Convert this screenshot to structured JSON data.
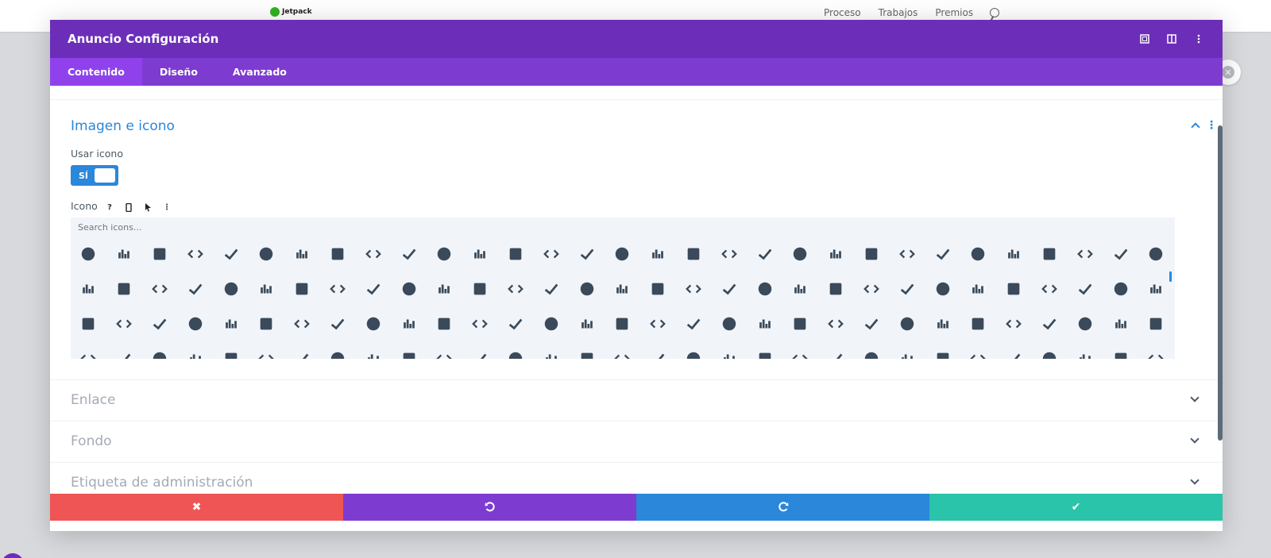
{
  "site": {
    "logo_text": "Jetpack",
    "nav": [
      "Proceso",
      "Trabajos",
      "Premios"
    ]
  },
  "modal": {
    "title": "Anuncio Configuración",
    "tabs": [
      {
        "label": "Contenido",
        "active": true
      },
      {
        "label": "Diseño",
        "active": false
      },
      {
        "label": "Avanzado",
        "active": false
      }
    ],
    "section": {
      "title": "Imagen e icono",
      "use_icon_label": "Usar icono",
      "toggle_value": "SÍ",
      "icon_label": "Icono",
      "search_placeholder": "Search icons..."
    },
    "collapsed_sections": [
      "Enlace",
      "Fondo",
      "Etiqueta de administración"
    ],
    "footer_colors": {
      "cancel": "#ef5555",
      "undo": "#7e3bd0",
      "redo": "#2b87da",
      "save": "#29c4a9"
    }
  },
  "icons": [
    "area-chart-icon",
    "bar-chart-icon",
    "bar-chart-outline-icon",
    "line-chart-icon",
    "pie-chart-icon",
    "check-icon",
    "check-circle-icon",
    "check-circle-outline-icon",
    "check-double-icon",
    "check-square-outline-icon",
    "check-square-icon",
    "chess-icon",
    "chess-bishop-icon",
    "chessboard-icon",
    "chess-king-icon",
    "chess-knight-icon",
    "chess-pawn-icon",
    "chess-queen-icon",
    "chess-rook-icon",
    "chevron-circle-down-icon",
    "chevron-circle-left-icon",
    "chevron-circle-right-icon",
    "chevron-circle-up-icon",
    "chevron-down-icon",
    "chevron-left-icon",
    "chevron-right-icon",
    "chevron-up-icon",
    "child-icon",
    "chrome-icon",
    "church-icon",
    "circle-icon",
    "circle-outline-icon",
    "circle-notch-icon",
    "clipboard-icon",
    "clipboard-solid-icon",
    "clipboard-check-icon",
    "clipboard-list-icon",
    "clock-outline-icon",
    "clock-icon",
    "clone-outline-icon",
    "clone-icon",
    "closed-captioning-icon",
    "closed-captioning-outline-icon",
    "cloud-icon",
    "cloud-download-icon",
    "cloud-upload-icon",
    "cloudscale-icon",
    "cloudsmith-icon",
    "cloudversify-icon",
    "cocktail-icon",
    "code-icon",
    "code-branch-icon",
    "codepen-icon",
    "codiepie-icon",
    "coffee-icon",
    "cog-icon",
    "cogs-icon",
    "coins-icon",
    "columns-icon",
    "comment-icon",
    "comment-outline-icon",
    "comment-square-outline-icon",
    "comment-alt-icon",
    "comment-dots-icon",
    "comment-dots-outline-icon",
    "comment-slash-icon",
    "comments-outline-icon",
    "comments-icon",
    "compact-disc-icon",
    "compass-outline-icon",
    "compass-icon",
    "compress-icon",
    "concierge-bell-icon",
    "connectdevelop-icon",
    "contao-icon",
    "cookie-icon",
    "cookie-bite-icon",
    "copy-outline-icon",
    "copy-icon",
    "copyright-outline-icon",
    "copyright-icon",
    "couch-icon",
    "cpanel-icon",
    "creative-commons-icon",
    "cc-by-icon",
    "cc-nc-icon",
    "cc-nc-eu-icon",
    "cc-nc-jp-icon",
    "cc-nd-icon",
    "cc-pd-icon",
    "cc-pd-alt-icon",
    "cc-remix-icon",
    "cc-sa-icon",
    "cc-sampling-icon",
    "cc-sampling-plus-icon",
    "cc-share-icon",
    "credit-card-icon",
    "credit-card-outline-icon",
    "crop-icon",
    "crop-alt-icon",
    "crosshairs-icon",
    "crow-icon",
    "crown-icon",
    "css3-icon",
    "css3-alt-icon",
    "cube-icon",
    "cubes-icon",
    "cut-icon",
    "cuttlefish-icon",
    "d-and-d-icon",
    "d-and-d-beyond-icon",
    "dashcube-icon",
    "database-icon",
    "deaf-icon",
    "delicious-icon",
    "deploydog-icon",
    "deskpro-icon",
    "desktop-icon",
    "dev-icon",
    "dharmachakra-icon",
    "dice-icon",
    "dice-five-icon",
    "dice-four-icon",
    "dice-one-icon",
    "dice-six-icon"
  ]
}
